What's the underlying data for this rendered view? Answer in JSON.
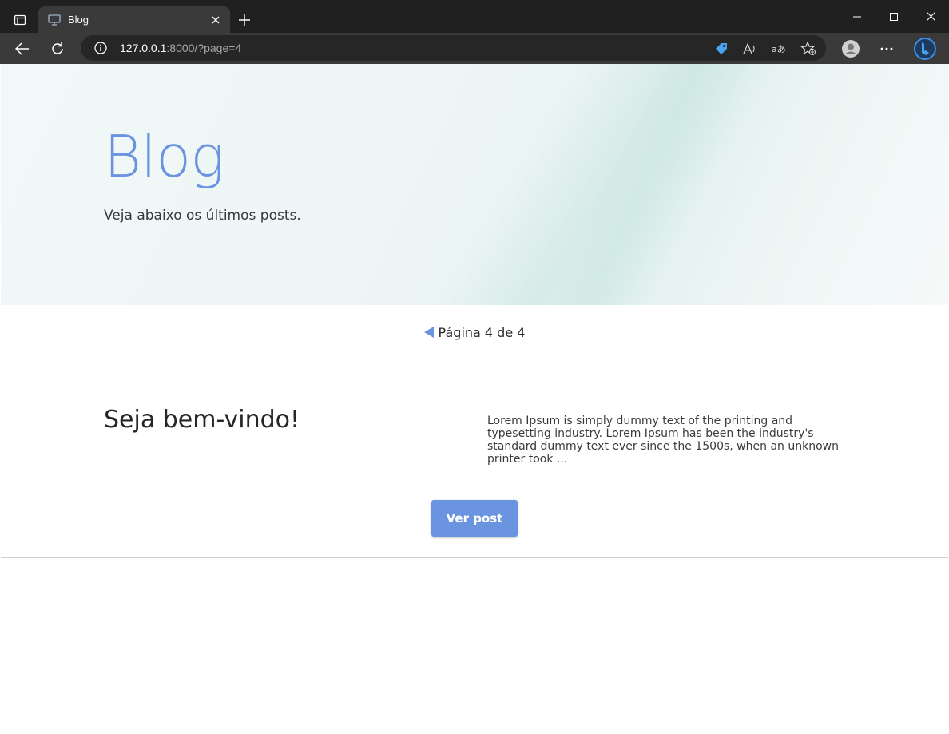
{
  "browser": {
    "tab": {
      "title": "Blog",
      "favicon": "monitor-icon"
    },
    "address": {
      "host": "127.0.0.1",
      "rest": ":8000/?page=4"
    },
    "icons": {
      "tab_actions": "tab-actions-icon",
      "close_tab": "close-icon",
      "new_tab": "plus-icon",
      "back": "back-arrow-icon",
      "refresh": "refresh-icon",
      "info": "info-icon",
      "coupon": "tag-icon",
      "read_aloud": "read-aloud-icon",
      "translate": "translate-icon",
      "favorite": "star-add-icon",
      "profile": "avatar-icon",
      "more": "ellipsis-icon",
      "copilot": "bing-icon"
    }
  },
  "hero": {
    "title": "Blog",
    "subtitle": "Veja abaixo os últimos posts."
  },
  "pagination": {
    "text": "Página 4 de 4"
  },
  "post": {
    "title": "Seja bem-vindo!",
    "excerpt": "Lorem Ipsum is simply dummy text of the printing and typesetting industry. Lorem Ipsum has been the industry's standard dummy text ever since the 1500s, when an unknown printer took ...",
    "button_label": "Ver post"
  },
  "colors": {
    "accent": "#6a93e0",
    "chrome_dark": "#202020",
    "chrome_toolbar": "#3a3a3a"
  }
}
